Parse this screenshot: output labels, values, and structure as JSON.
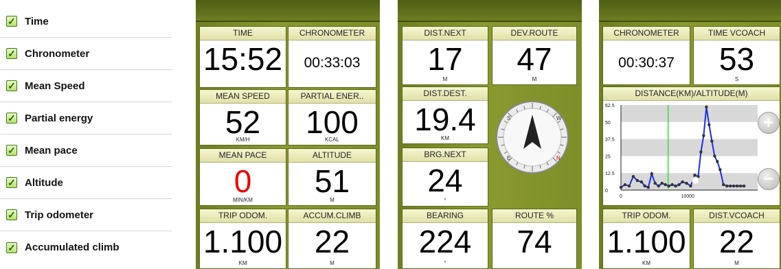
{
  "checklist": [
    {
      "label": "Time",
      "checked": true
    },
    {
      "label": "Chronometer",
      "checked": true
    },
    {
      "label": "Mean Speed",
      "checked": true
    },
    {
      "label": "Partial energy",
      "checked": true
    },
    {
      "label": "Mean pace",
      "checked": true
    },
    {
      "label": "Altitude",
      "checked": true
    },
    {
      "label": "Trip odometer",
      "checked": true
    },
    {
      "label": "Accumulated climb",
      "checked": true
    }
  ],
  "check_mark": "✓",
  "screens": [
    {
      "fields": [
        {
          "label": "TIME",
          "value": "15:52",
          "unit": ""
        },
        {
          "label": "CHRONOMETER",
          "value": "00:33:03",
          "unit": ""
        },
        {
          "label": "MEAN SPEED",
          "value": "52",
          "unit": "KM/H"
        },
        {
          "label": "PARTIAL ENER..",
          "value": "100",
          "unit": "KCAL"
        },
        {
          "label": "MEAN PACE",
          "value": "0",
          "unit": "MIN/KM",
          "value_color": "#ee0000"
        },
        {
          "label": "ALTITUDE",
          "value": "51",
          "unit": "M"
        },
        {
          "label": "TRIP ODOM.",
          "value": "1.100",
          "unit": "KM"
        },
        {
          "label": "ACCUM.CLIMB",
          "value": "22",
          "unit": "M"
        }
      ]
    },
    {
      "fields": [
        {
          "label": "DIST.NEXT",
          "value": "17",
          "unit": "M"
        },
        {
          "label": "DEV.ROUTE",
          "value": "47",
          "unit": "M"
        },
        {
          "label": "DIST.DEST.",
          "value": "19.4",
          "unit": "KM"
        },
        {
          "label": "BRG.NEXT",
          "value": "24",
          "unit": "°"
        },
        {
          "label": "BEARING",
          "value": "224",
          "unit": "°"
        },
        {
          "label": "ROUTE %",
          "value": "74",
          "unit": ""
        }
      ],
      "compass": {
        "labels": [
          "S",
          "W",
          "E",
          "N"
        ],
        "icon": "compass-icon"
      }
    },
    {
      "fields": [
        {
          "label": "CHRONOMETER",
          "value": "00:30:37",
          "unit": ""
        },
        {
          "label": "TIME VCOACH",
          "value": "53",
          "unit": "S"
        },
        {
          "label": "TRIP ODOM.",
          "value": "1.100",
          "unit": "KM"
        },
        {
          "label": "DIST.VCOACH",
          "value": "22",
          "unit": "M"
        }
      ],
      "chart_title": "DISTANCE(KM)/ALTITUDE(M)",
      "zoom_in": "+",
      "zoom_out": "−"
    }
  ],
  "chart_data": {
    "type": "line",
    "title": "DISTANCE(KM)/ALTITUDE(M)",
    "xlabel": "",
    "ylabel": "",
    "xlim": [
      0,
      20000
    ],
    "ylim": [
      0,
      62.5
    ],
    "yticks": [
      "62.5",
      "50",
      "37.5",
      "25",
      "12.5",
      "0"
    ],
    "xticks": [
      "0",
      "10000"
    ],
    "grid": true,
    "series": [
      {
        "color": "#1a2ee0",
        "x": [
          0,
          600,
          1200,
          1800,
          2400,
          3000,
          3500,
          4000,
          4500,
          5000,
          5500,
          6000,
          6500,
          7000,
          7500,
          8000,
          8500,
          9000,
          9600,
          10200,
          10800,
          11300,
          11700,
          12100,
          12500,
          12900,
          13300,
          13700,
          14100,
          14500,
          15000,
          15500,
          16000,
          16500,
          17000,
          17500,
          18000
        ],
        "y": [
          2,
          4,
          3,
          10,
          7,
          6,
          3,
          2,
          12,
          5,
          3,
          5,
          4,
          3,
          4,
          3,
          4,
          6,
          5,
          3,
          11,
          10,
          28,
          40,
          61,
          48,
          36,
          25,
          21,
          15,
          4,
          3,
          3,
          3,
          3,
          3,
          3
        ]
      }
    ],
    "vertical_marker_x": 6900,
    "marker_point": {
      "x": 10900,
      "y": 7
    }
  }
}
